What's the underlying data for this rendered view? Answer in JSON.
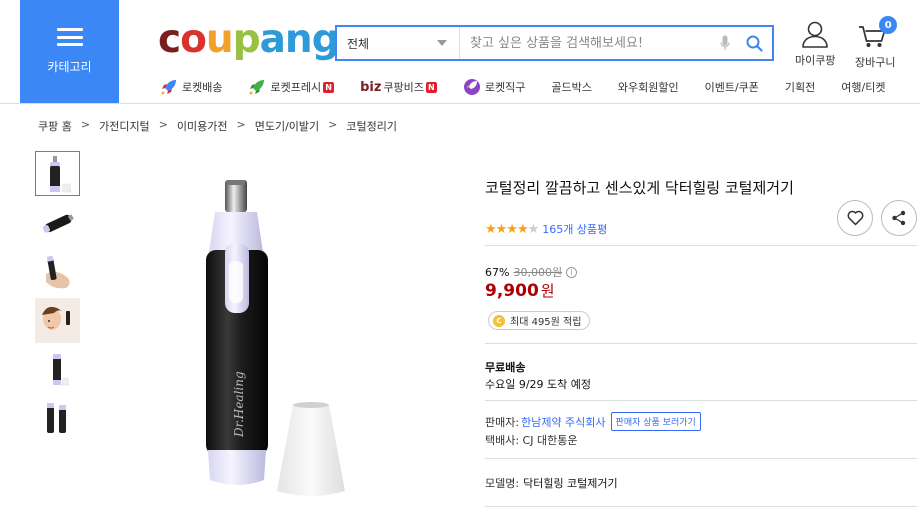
{
  "header": {
    "category_label": "카테고리",
    "logo_parts": [
      "c",
      "o",
      "u",
      "p",
      "ang"
    ],
    "search": {
      "category": "전체",
      "placeholder": "찾고 싶은 상품을 검색해보세요!"
    },
    "my_coupang": "마이쿠팡",
    "cart": "장바구니",
    "cart_count": "0"
  },
  "nav": [
    {
      "label": "로켓배송",
      "icon": "rocket-icon"
    },
    {
      "label": "로켓프레시",
      "icon": "rocket-fresh-icon",
      "new": "N"
    },
    {
      "label": "쿠팡비즈",
      "prefix": "biz",
      "new": "N"
    },
    {
      "label": "로켓직구",
      "icon": "rocket-global-icon"
    },
    {
      "label": "골드박스"
    },
    {
      "label": "와우회원할인"
    },
    {
      "label": "이벤트/쿠폰"
    },
    {
      "label": "기획전"
    },
    {
      "label": "여행/티켓"
    }
  ],
  "breadcrumb": [
    "쿠팡 홈",
    "가전디지털",
    "이미용가전",
    "면도기/이발기",
    "코털정리기"
  ],
  "breadcrumb_sep": ">",
  "product": {
    "title": "코털정리 깔끔하고 센스있게 닥터힐링 코털제거기",
    "rating": 4,
    "rating_max": 5,
    "review_count": "165개 상품평",
    "discount_rate": "67%",
    "original_price": "30,000원",
    "price": "9,900",
    "price_unit": "원",
    "reward": "최대 495원 적립",
    "reward_coin": "C",
    "shipping_title": "무료배송",
    "shipping_date": "수요일 9/29 도착 예정",
    "seller_label": "판매자:",
    "seller_name": "한남제약 주식회사",
    "seller_button": "판매자 상품 보러가기",
    "courier": "택배사: CJ 대한통운",
    "model_label": "모델명:",
    "model_name": "닥터힐링 코털제거기",
    "device_text": "Dr.Healing"
  },
  "colors": {
    "accent": "#3b87f5",
    "price": "#ae0000",
    "link": "#346aff",
    "star": "#f4a21b"
  }
}
